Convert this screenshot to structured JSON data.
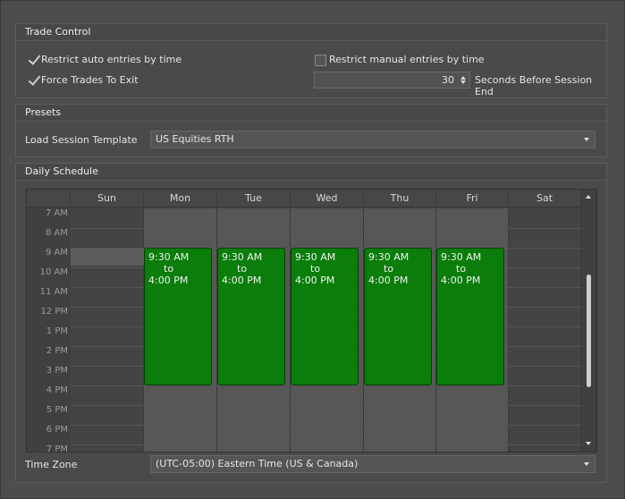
{
  "trade_control": {
    "title": "Trade Control",
    "restrict_auto_label": "Restrict auto entries by time",
    "restrict_auto_checked": true,
    "force_trades_label": "Force Trades To Exit",
    "force_trades_checked": true,
    "restrict_manual_label": "Restrict manual entries by time",
    "restrict_manual_checked": false,
    "seconds_value": "30",
    "seconds_label": "Seconds Before Session End"
  },
  "presets": {
    "title": "Presets",
    "template_label": "Load Session Template",
    "template_value": "US Equities RTH"
  },
  "daily_schedule": {
    "title": "Daily Schedule",
    "days": [
      "Sun",
      "Mon",
      "Tue",
      "Wed",
      "Thu",
      "Fri",
      "Sat"
    ],
    "time_labels": [
      "7 AM",
      "8 AM",
      "9 AM",
      "10 AM",
      "11 AM",
      "12 PM",
      "1 PM",
      "2 PM",
      "3 PM",
      "4 PM",
      "5 PM",
      "6 PM",
      "7 PM"
    ],
    "events": [
      {
        "day": "Mon",
        "start": "9:30 AM",
        "sep": "to",
        "end": "4:00 PM"
      },
      {
        "day": "Tue",
        "start": "9:30 AM",
        "sep": "to",
        "end": "4:00 PM"
      },
      {
        "day": "Wed",
        "start": "9:30 AM",
        "sep": "to",
        "end": "4:00 PM"
      },
      {
        "day": "Thu",
        "start": "9:30 AM",
        "sep": "to",
        "end": "4:00 PM"
      },
      {
        "day": "Fri",
        "start": "9:30 AM",
        "sep": "to",
        "end": "4:00 PM"
      }
    ],
    "time_zone_label": "Time Zone",
    "time_zone_value": "(UTC-05:00) Eastern Time (US & Canada)"
  },
  "colors": {
    "event_green": "#0a7d0a",
    "background": "#4d4d4d"
  }
}
